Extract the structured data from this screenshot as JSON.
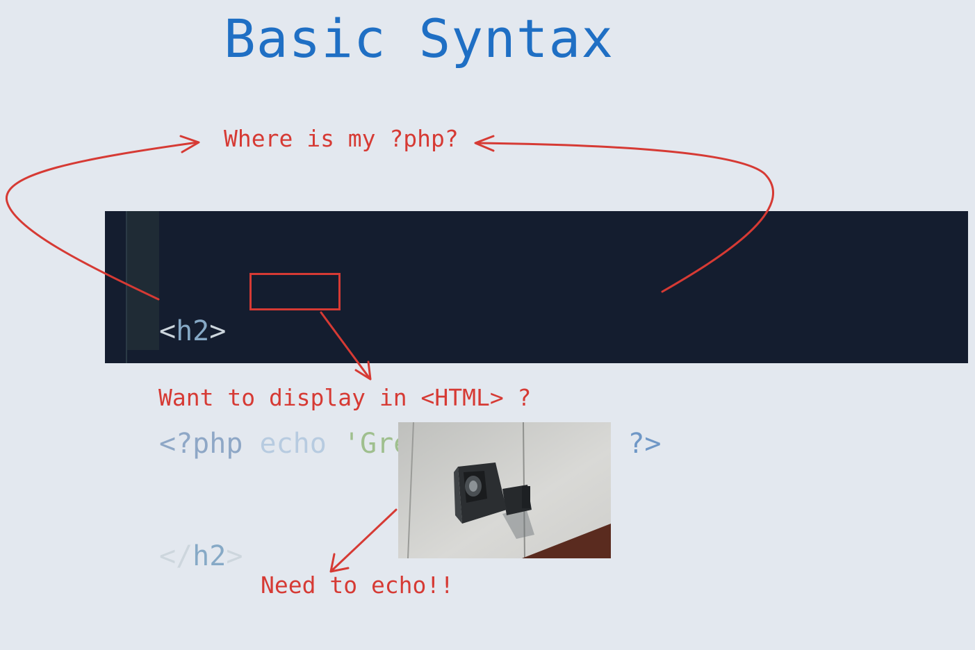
{
  "title": "Basic Syntax",
  "annotations": {
    "top": "Where is my ?php?",
    "middle": "Want to display in <HTML> ?",
    "bottom": "Need to echo!!"
  },
  "code": {
    "line1": {
      "open": "<",
      "name": "h2",
      "close": ">"
    },
    "line2": {
      "php_open": "<?php",
      "echo": "echo",
      "string": "'Great PHP page'",
      "php_close": "?>"
    },
    "line3": {
      "open": "</",
      "name": "h2",
      "close": ">"
    }
  },
  "colors": {
    "background": "#e3e8ef",
    "title": "#1f6fc4",
    "annotation": "#d63a34",
    "code_background": "#141d2f"
  },
  "image": {
    "subject": "loudspeaker-horn-on-wall"
  }
}
